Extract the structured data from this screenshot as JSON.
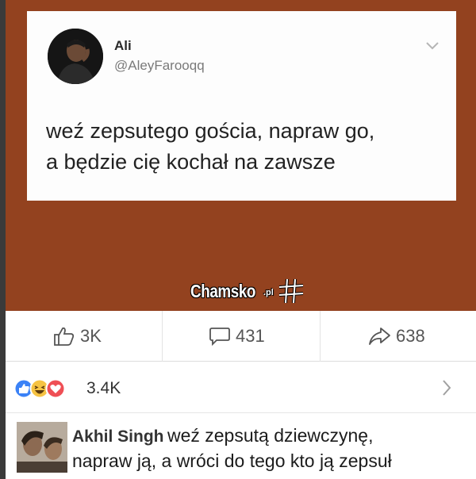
{
  "tweet": {
    "name": "Ali",
    "handle": "@AleyFarooqq",
    "text_line1": "weź zepsutego gościa, napraw go,",
    "text_line2": "a będzie cię kochał na zawsze"
  },
  "watermark": {
    "brand": "Chamsko",
    "tld": ".pl"
  },
  "actions": {
    "like_count": "3K",
    "comment_count": "431",
    "share_count": "638"
  },
  "reactions": {
    "icons": [
      "like-icon",
      "haha-icon",
      "love-icon"
    ],
    "count": "3.4K"
  },
  "comment": {
    "author": "Akhil Singh",
    "text_line1": "weź zepsutą dziewczynę,",
    "text_line2": "napraw ją, a wróci do tego kto ją zepsuł"
  },
  "colors": {
    "background_brown": "#93421f",
    "like_blue": "#3b82f6",
    "love_red": "#ef4f55",
    "haha_yellow": "#f6c343"
  }
}
